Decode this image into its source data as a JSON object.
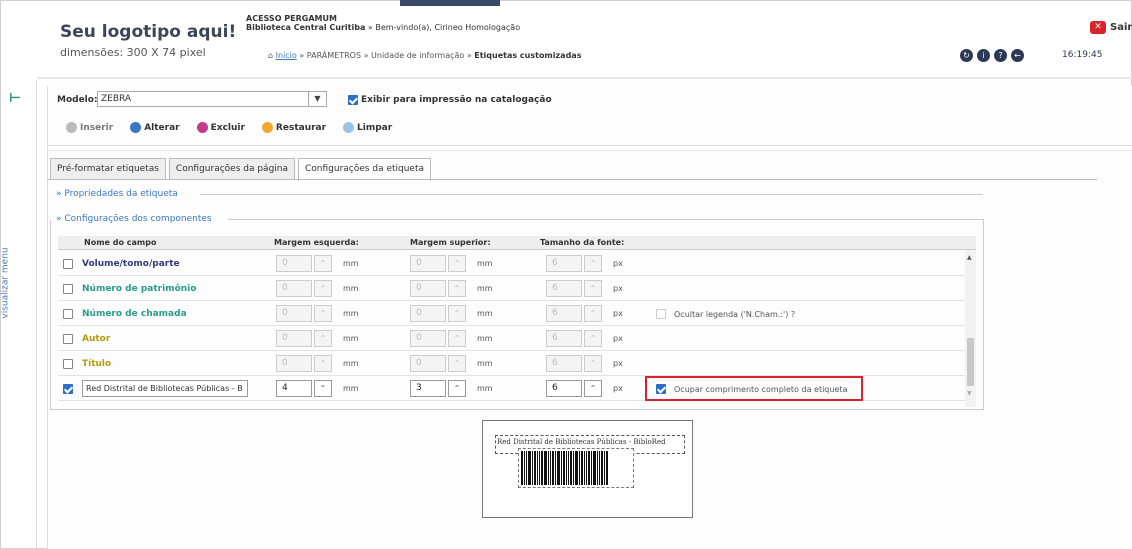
{
  "header": {
    "logo_title": "Seu logotipo aqui!",
    "logo_dims": "dimensões: 300 X 74 pixel",
    "acesso": "ACESSO PERGAMUM",
    "library": "Biblioteca Central Curitiba",
    "welcome": " » Bem-vindo(a), Cirineo Homologação",
    "breadcrumb": {
      "home": "Início",
      "parametros": " » PARÂMETROS » Unidade de informação » ",
      "current": "Etiquetas customizadas"
    },
    "exit_label": "Sair",
    "clock": "16:19:45",
    "icons": [
      "refresh-icon",
      "help-icon",
      "question-icon",
      "back-icon"
    ]
  },
  "sidebar": {
    "menu_label": "visualizar menu"
  },
  "form": {
    "modelo_label": "Modelo:",
    "modelo_value": "ZEBRA",
    "exibir_label": "Exibir para impressão na catalogação",
    "exibir_checked": true
  },
  "toolbar": {
    "inserir": "Inserir",
    "alterar": "Alterar",
    "excluir": "Excluir",
    "restaurar": "Restaurar",
    "limpar": "Limpar"
  },
  "tabs": [
    "Pré-formatar etiquetas",
    "Configurações da página",
    "Configurações da etiqueta"
  ],
  "sections": {
    "propriedades": "» Propriedades da etiqueta",
    "componentes": "» Configurações dos componentes"
  },
  "table": {
    "headers": [
      "Nome do campo",
      "Margem esquerda:",
      "Margem superior:",
      "Tamanho da fonte:"
    ],
    "unit_mm": "mm",
    "unit_px": "px",
    "rows": [
      {
        "name": "Volume/tomo/parte",
        "left": "0",
        "top": "0",
        "font": "6",
        "checked": false,
        "color": "#2d3e7a"
      },
      {
        "name": "Número de patrimônio",
        "left": "0",
        "top": "0",
        "font": "6",
        "checked": false,
        "color": "#2a9a8a"
      },
      {
        "name": "Número de chamada",
        "left": "0",
        "top": "0",
        "font": "6",
        "checked": false,
        "color": "#2a9a8a",
        "extra": "Ocultar legenda ('N.Cham.:') ?"
      },
      {
        "name": "Autor",
        "left": "0",
        "top": "0",
        "font": "6",
        "checked": false,
        "color": "#b49a10"
      },
      {
        "name": "Título",
        "left": "0",
        "top": "0",
        "font": "6",
        "checked": false,
        "color": "#b49a10"
      },
      {
        "name": "Red Distrital de Bibliotecas Públicas - B",
        "left": "4",
        "top": "3",
        "font": "6",
        "checked": true,
        "color": "#222",
        "extra": "Ocupar comprimento completo da etiqueta"
      }
    ]
  },
  "preview": {
    "text": "Red Distrital de Bibliotecas Públicas - BibloRed"
  },
  "colors": {
    "accent": "#3a78c2",
    "highlight": "#d6242a",
    "check": "#2d6fc7"
  }
}
